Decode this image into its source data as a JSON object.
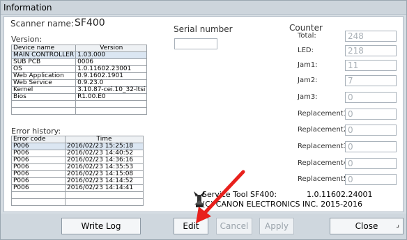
{
  "window": {
    "title": "Information"
  },
  "scanner": {
    "label": "Scanner name:",
    "model": "SF400"
  },
  "version": {
    "label": "Version:",
    "headers": [
      "Device name",
      "Version"
    ],
    "rows": [
      [
        "MAIN CONTROLLER",
        "1.03.000"
      ],
      [
        "SUB PCB",
        "0006"
      ],
      [
        "OS",
        "1.0.11602.23001"
      ],
      [
        "Web Application",
        "0.9.1602.1901"
      ],
      [
        "Web Service",
        "0.9.23.0"
      ],
      [
        "Kernel",
        "3.10.87-cei.10_32-ltsi"
      ],
      [
        "Bios",
        "R1.00.E0"
      ],
      [
        "",
        ""
      ],
      [
        "",
        ""
      ]
    ]
  },
  "errors": {
    "label": "Error history:",
    "headers": [
      "Error code",
      "Time"
    ],
    "rows": [
      [
        "P006",
        "2016/02/23 15:25:18"
      ],
      [
        "P006",
        "2016/02/23 14:40:52"
      ],
      [
        "P006",
        "2016/02/23 14:36:16"
      ],
      [
        "P006",
        "2016/02/23 14:35:53"
      ],
      [
        "P006",
        "2016/02/23 14:15:08"
      ],
      [
        "P006",
        "2016/02/23 14:14:52"
      ],
      [
        "P006",
        "2016/02/23 14:14:41"
      ],
      [
        "",
        ""
      ],
      [
        "",
        ""
      ]
    ]
  },
  "serial": {
    "label": "Serial number",
    "value": ""
  },
  "counter": {
    "label": "Counter",
    "items": [
      {
        "label": "Total:",
        "value": "248"
      },
      {
        "label": "LED:",
        "value": "218"
      },
      {
        "label": "Jam1:",
        "value": "11"
      },
      {
        "label": "Jam2:",
        "value": "7"
      },
      {
        "label": "Jam3:",
        "value": "0"
      },
      {
        "label": "Replacement1:",
        "value": "0"
      },
      {
        "label": "Replacement2:",
        "value": "0"
      },
      {
        "label": "Replacement3:",
        "value": "0"
      },
      {
        "label": "Replacement4:",
        "value": "0"
      },
      {
        "label": "Replacement5:",
        "value": "0"
      }
    ]
  },
  "about": {
    "line1_name": "Service Tool SF400:",
    "line1_version": "1.0.11602.24001",
    "line2": "(C) CANON ELECTRONICS INC. 2015-2016",
    "icon": "service-tool-icon"
  },
  "buttons": {
    "write_log": "Write Log",
    "edit": "Edit",
    "cancel": "Cancel",
    "apply": "Apply",
    "close": "Close"
  },
  "colors": {
    "annotation_arrow": "#e8201c"
  }
}
